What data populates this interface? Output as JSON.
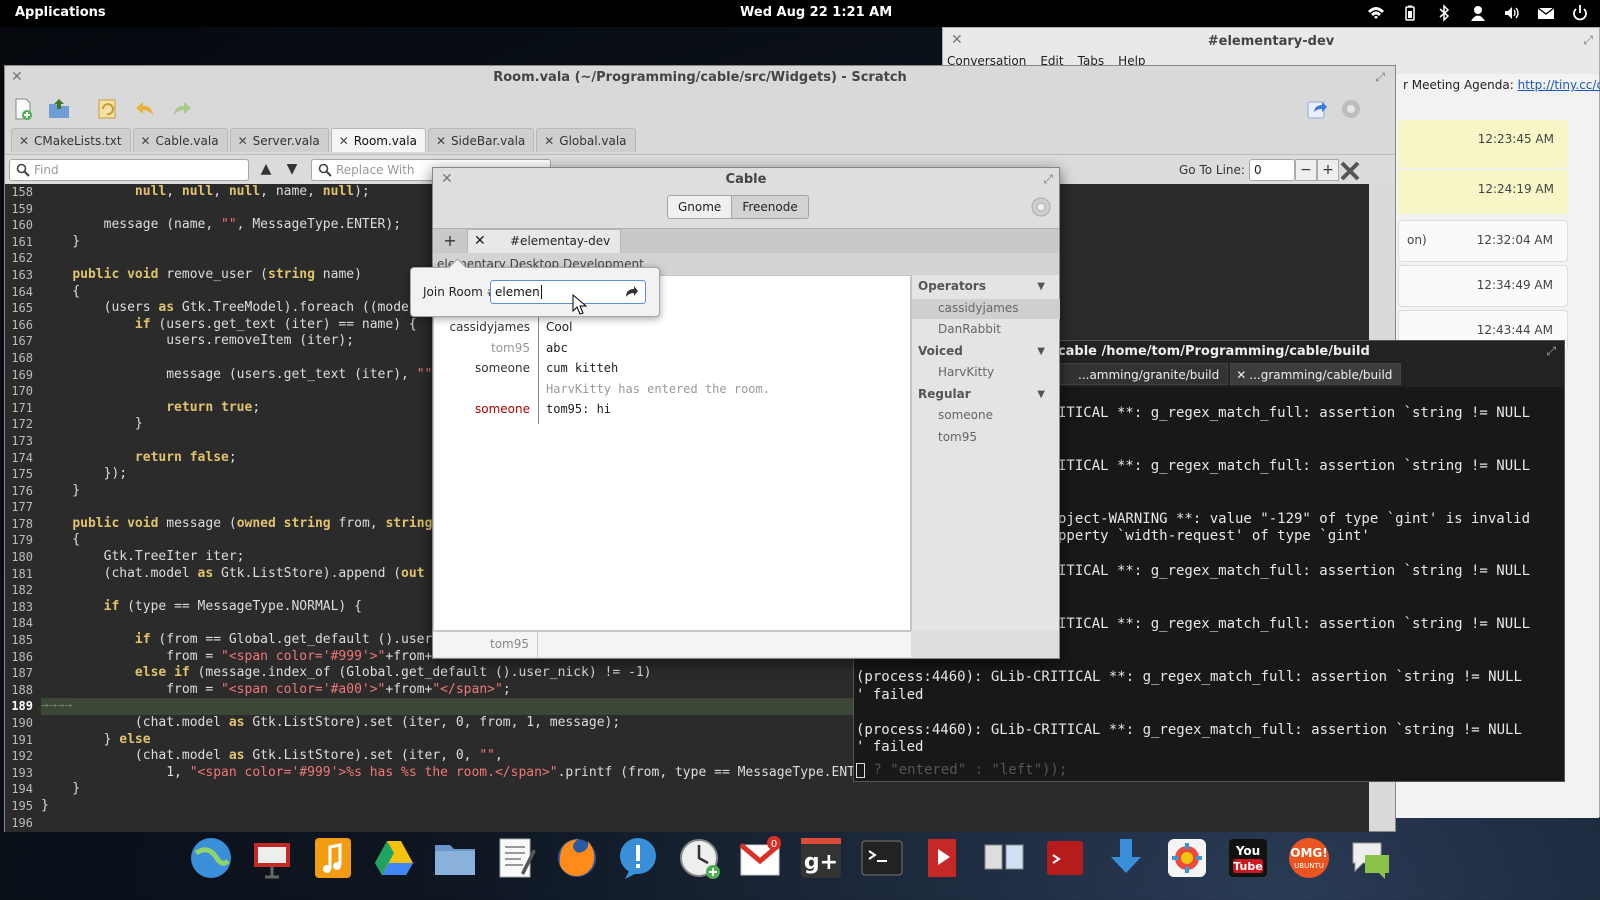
{
  "top_panel": {
    "applications": "Applications",
    "clock": "Wed Aug 22  1:21 AM",
    "indicators": [
      "wifi-icon",
      "battery-icon",
      "bluetooth-icon",
      "user-icon",
      "volume-icon",
      "mail-icon",
      "power-icon"
    ]
  },
  "chat_window": {
    "title": "#elementary-dev",
    "menu": [
      "Conversation",
      "Edit",
      "Tabs",
      "Help"
    ],
    "agenda_prefix": "r Meeting Agenda: ",
    "agenda_link": "http://tiny.cc/co...",
    "messages": [
      {
        "fragment": "",
        "time": "12:23:45 AM",
        "highlight": true
      },
      {
        "fragment": "",
        "time": "12:24:19 AM",
        "highlight": true
      },
      {
        "fragment": "on)",
        "time": "12:32:04 AM",
        "highlight": false
      },
      {
        "fragment": "",
        "time": "12:34:49 AM",
        "highlight": false
      },
      {
        "fragment": "",
        "time": "12:43:44 AM",
        "highlight": false
      }
    ]
  },
  "editor": {
    "title": "Room.vala (~/Programming/cable/src/Widgets) - Scratch",
    "tabs": [
      {
        "label": "CMakeLists.txt",
        "active": false
      },
      {
        "label": "Cable.vala",
        "active": false
      },
      {
        "label": "Server.vala",
        "active": false
      },
      {
        "label": "Room.vala",
        "active": true
      },
      {
        "label": "SideBar.vala",
        "active": false
      },
      {
        "label": "Global.vala",
        "active": false
      }
    ],
    "find_placeholder": "Find",
    "replace_placeholder": "Replace With",
    "goto_label": "Go To Line:",
    "goto_value": "0",
    "line_numbers": [
      "158",
      "159",
      "160",
      "161",
      "162",
      "163",
      "164",
      "165",
      "166",
      "167",
      "168",
      "169",
      "170",
      "171",
      "172",
      "173",
      "174",
      "175",
      "176",
      "177",
      "178",
      "179",
      "180",
      "181",
      "182",
      "183",
      "184",
      "185",
      "186",
      "187",
      "188",
      "189",
      "190",
      "191",
      "192",
      "193",
      "194",
      "195",
      "196"
    ],
    "highlight_line": "189",
    "code_lines": [
      "            null, null, null, name, null);",
      "",
      "        message (name, \"\", MessageType.ENTER);",
      "    }",
      "",
      "    public void remove_user (string name)",
      "    {",
      "        (users as Gtk.TreeModel).foreach ((model",
      "            if (users.get_text (iter) == name) {",
      "                users.removeItem (iter);",
      "",
      "                message (users.get_text (iter), \"\"",
      "",
      "                return true;",
      "            }",
      "",
      "            return false;",
      "        });",
      "    }",
      "",
      "    public void message (owned string from, string",
      "    {",
      "        Gtk.TreeIter iter;",
      "        (chat.model as Gtk.ListStore).append (out",
      "",
      "        if (type == MessageType.NORMAL) {",
      "",
      "            if (from == Global.get_default ().user",
      "                from = \"<span color='#999'>\"+from+",
      "            else if (message.index_of (Global.get_default ().user_nick) != -1)",
      "                from = \"<span color='#a00'>\"+from+\"</span>\";",
      "→→→→",
      "            (chat.model as Gtk.ListStore).set (iter, 0, from, 1, message);",
      "        } else",
      "            (chat.model as Gtk.ListStore).set (iter, 0, \"\",",
      "                1, \"<span color='#999'>%s has %s the room.</span>\".printf (from, type == MessageType.ENTER",
      "    }",
      "}",
      ""
    ]
  },
  "terminal": {
    "title": "./cable  /home/tom/Programming/cable/build",
    "tabs": [
      {
        "label": "...amming/granite/build",
        "active": false
      },
      {
        "label": "...gramming/cable/build",
        "active": true
      }
    ],
    "lines": [
      {
        "text": "ITICAL **: g_regex_match_full: assertion `string != NULL",
        "row": 0
      },
      {
        "text": "ITICAL **: g_regex_match_full: assertion `string != NULL",
        "row": 3
      },
      {
        "text": "oject-WARNING **: value \"-129\" of type `gint' is invalid",
        "row": 6
      },
      {
        "text": "pperty `width-request' of type `gint'",
        "row": 7
      },
      {
        "text": "ITICAL **: g_regex_match_full: assertion `string != NULL",
        "row": 9
      },
      {
        "text": "ITICAL **: g_regex_match_full: assertion `string != NULL",
        "row": 12
      },
      {
        "text": "(process:4460): GLib-CRITICAL **: g_regex_match_full: assertion `string != NULL",
        "row": 15
      },
      {
        "text": "' failed",
        "row": 16
      },
      {
        "text": "(process:4460): GLib-CRITICAL **: g_regex_match_full: assertion `string != NULL",
        "row": 18
      },
      {
        "text": "' failed",
        "row": 19
      }
    ],
    "trailing": " ? \"entered\" : \"left\"));"
  },
  "cable": {
    "title": "Cable",
    "servers": [
      {
        "label": "Gnome",
        "active": false
      },
      {
        "label": "Freenode",
        "active": true
      }
    ],
    "room_tab": "#elementay-dev",
    "topic": "elementary Desktop Development",
    "messages": [
      {
        "nick": "cassidyjames",
        "text": "Cool",
        "nick_color": "#333333",
        "text_color": "#222222"
      },
      {
        "nick": "tom95",
        "text": "abc",
        "nick_color": "#999999",
        "text_color": "#222222"
      },
      {
        "nick": "someone",
        "text": "cum kitteh",
        "nick_color": "#333333",
        "text_color": "#222222"
      },
      {
        "nick": "",
        "text": "HarvKitty has entered the room.",
        "nick_color": "#999999",
        "text_color": "#999999"
      },
      {
        "nick": "someone",
        "text": "tom95: hi",
        "nick_color": "#aa0000",
        "text_color": "#222222"
      }
    ],
    "user_groups": [
      {
        "name": "Operators",
        "users": [
          "cassidyjames",
          "DanRabbit"
        ]
      },
      {
        "name": "Voiced",
        "users": [
          "HarvKitty"
        ]
      },
      {
        "name": "Regular",
        "users": [
          "someone",
          "tom95"
        ]
      }
    ],
    "selected_user": "cassidyjames",
    "input_nick": "tom95",
    "join": {
      "label": "Join Room #",
      "value": "elemen"
    }
  },
  "dock": [
    "network-icon",
    "presentation-icon",
    "music-icon",
    "drive-icon",
    "folder-icon",
    "text-editor-icon",
    "firefox-icon",
    "chat-icon",
    "clock-icon",
    "gmail-icon",
    "google-plus-icon",
    "terminal-icon",
    "video-icon",
    "window-switcher-icon",
    "app-icon",
    "download-icon",
    "settings-icon",
    "youtube-icon",
    "omg-ubuntu-icon",
    "messages-icon"
  ],
  "colors": {
    "accent": "#5b8fd4",
    "code_bg": "#2b2b2b",
    "keyword": "#e0c36a",
    "string": "#ee7777",
    "mention": "#aa0000"
  }
}
